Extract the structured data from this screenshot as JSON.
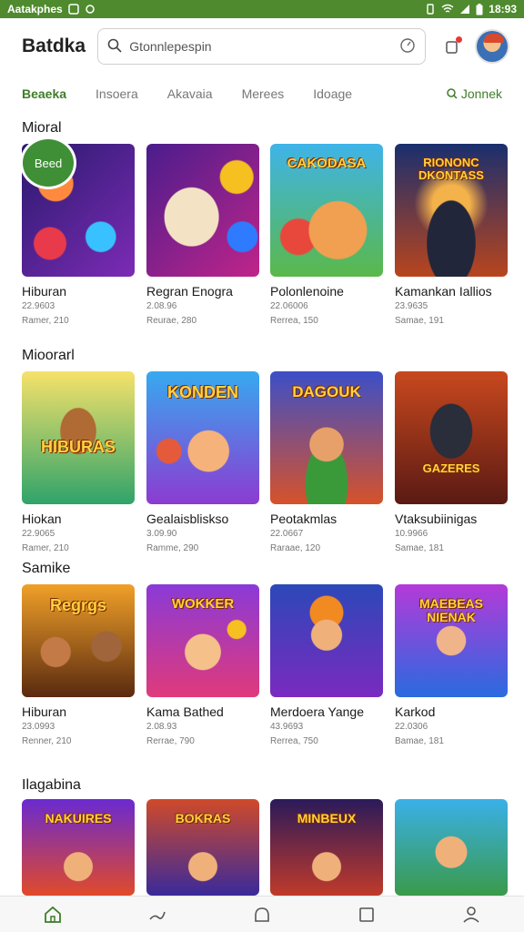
{
  "status": {
    "left_text": "Aatakphes",
    "time": "18:93"
  },
  "header": {
    "title": "Batdka",
    "search_placeholder": "Gtonnlepespin"
  },
  "tabs": [
    {
      "label": "Beaeka",
      "active": true
    },
    {
      "label": "Insoera",
      "active": false
    },
    {
      "label": "Akavaia",
      "active": false
    },
    {
      "label": "Merees",
      "active": false
    },
    {
      "label": "Idoage",
      "active": false
    }
  ],
  "tabs_more": "Jonnek",
  "badge": "Beed",
  "sections": [
    {
      "title": "Mioral",
      "cards": [
        {
          "title": "Hiburan",
          "meta": "22.9603",
          "sub": "Ramer, 210",
          "art": ""
        },
        {
          "title": "Regran Enogra",
          "meta": "2.08.96",
          "sub": "Reurae, 280",
          "art": ""
        },
        {
          "title": "Polonlenoine",
          "meta": "22.06006",
          "sub": "Rerrea, 150",
          "art": "CAKODASA"
        },
        {
          "title": "Kamankan Iallios",
          "meta": "23.9635",
          "sub": "Samae, 191",
          "art": "RIONONC DKONTASS"
        }
      ]
    },
    {
      "title": "Mioorarl",
      "cards": [
        {
          "title": "Hiokan",
          "meta": "22.9065",
          "sub": "Ramer, 210",
          "art": "HIBURAS"
        },
        {
          "title": "Gealaisbliskso",
          "meta": "3.09.90",
          "sub": "Ramme, 290",
          "art": "KONDEN"
        },
        {
          "title": "Peotakmlas",
          "meta": "22.0667",
          "sub": "Raraae, 120",
          "art": "DAGOUK"
        },
        {
          "title": "Vtaksubiinigas",
          "meta": "10.9966",
          "sub": "Samae, 181",
          "art": "GAZERES"
        }
      ]
    },
    {
      "title": "Samike",
      "cards": [
        {
          "title": "Hiburan",
          "meta": "23.0993",
          "sub": "Renner, 210",
          "art": "Regrgs"
        },
        {
          "title": "Kama Bathed",
          "meta": "2.08.93",
          "sub": "Rerrae, 790",
          "art": "WOKKER"
        },
        {
          "title": "Merdoera Yange",
          "meta": "43.9693",
          "sub": "Rerrea, 750",
          "art": ""
        },
        {
          "title": "Karkod",
          "meta": "22.0306",
          "sub": "Bamae, 181",
          "art": "MAEBEAS NIENAK"
        }
      ]
    },
    {
      "title": "Ilagabina",
      "cards": [
        {
          "title": "",
          "meta": "",
          "sub": "",
          "art": "NAKUIRES"
        },
        {
          "title": "",
          "meta": "",
          "sub": "",
          "art": "BOKRAS"
        },
        {
          "title": "",
          "meta": "",
          "sub": "",
          "art": "MINBEUX"
        },
        {
          "title": "",
          "meta": "",
          "sub": "",
          "art": ""
        }
      ]
    }
  ],
  "bottom_nav": [
    {
      "icon": "home-icon",
      "active": true
    },
    {
      "icon": "gesture-icon",
      "active": false
    },
    {
      "icon": "circle-icon",
      "active": false
    },
    {
      "icon": "square-icon",
      "active": false
    },
    {
      "icon": "profile-icon",
      "active": false
    }
  ],
  "colors": {
    "accent": "#3f7d2a",
    "status_bar": "#4f8a2e"
  }
}
